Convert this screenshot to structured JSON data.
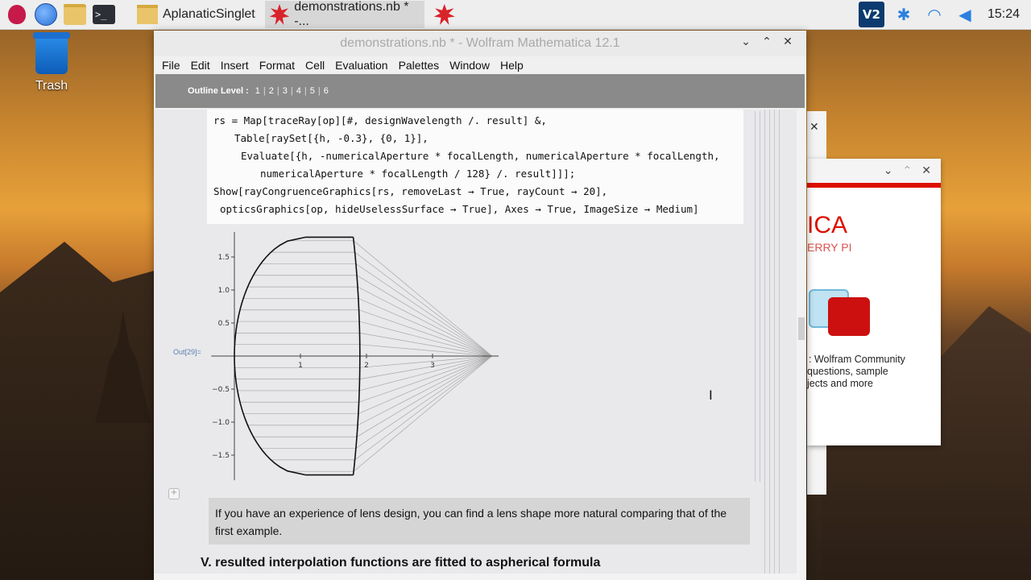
{
  "taskbar": {
    "tasks": [
      {
        "label": "AplanaticSinglet"
      },
      {
        "label": "demonstrations.nb * -..."
      },
      {
        "label": ""
      }
    ],
    "clock": "15:24",
    "vnc_label": "V2"
  },
  "desktop": {
    "trash_label": "Trash"
  },
  "welcome_window": {
    "brand": "ICA",
    "brand_sub": "ERRY PI",
    "community_text": "Wolfram Community",
    "line2": "questions, sample",
    "line3": "jects and more"
  },
  "window": {
    "title": "demonstrations.nb * - Wolfram Mathematica 12.1",
    "menu": [
      "File",
      "Edit",
      "Insert",
      "Format",
      "Cell",
      "Evaluation",
      "Palettes",
      "Window",
      "Help"
    ],
    "toolbar": {
      "outline_label": "Outline Level :",
      "levels": [
        "1",
        "2",
        "3",
        "4",
        "5",
        "6"
      ]
    }
  },
  "notebook": {
    "code_lines": [
      "rs = Map[traceRay[op][#, designWavelength /. result] &,",
      "Table[raySet[{h, -0.3}, {0, 1}],",
      "Evaluate[{h, -numericalAperture * focalLength, numericalAperture * focalLength,",
      "numericalAperture * focalLength / 128} /. result]]];",
      "Show[rayCongruenceGraphics[rs, removeLast → True, rayCount → 20],",
      "opticsGraphics[op, hideUselessSurface → True], Axes → True, ImageSize → Medium]"
    ],
    "out_label": "Out[29]=",
    "text_cell": "If you have an experience of lens design, you can find a lens shape more natural comparing that of the first example.",
    "heading": "V. resulted interpolation functions are fitted to aspherical formula"
  },
  "plot": {
    "x_ticks": [
      "1",
      "2",
      "3"
    ],
    "y_ticks": [
      "1.5",
      "1.0",
      "0.5",
      "−0.5",
      "−1.0",
      "−1.5"
    ],
    "ray_count": 20,
    "focus_x": 3.9,
    "lens": {
      "front_vertex_x": 0,
      "back_x": 1.9,
      "half_height": 1.8
    }
  }
}
